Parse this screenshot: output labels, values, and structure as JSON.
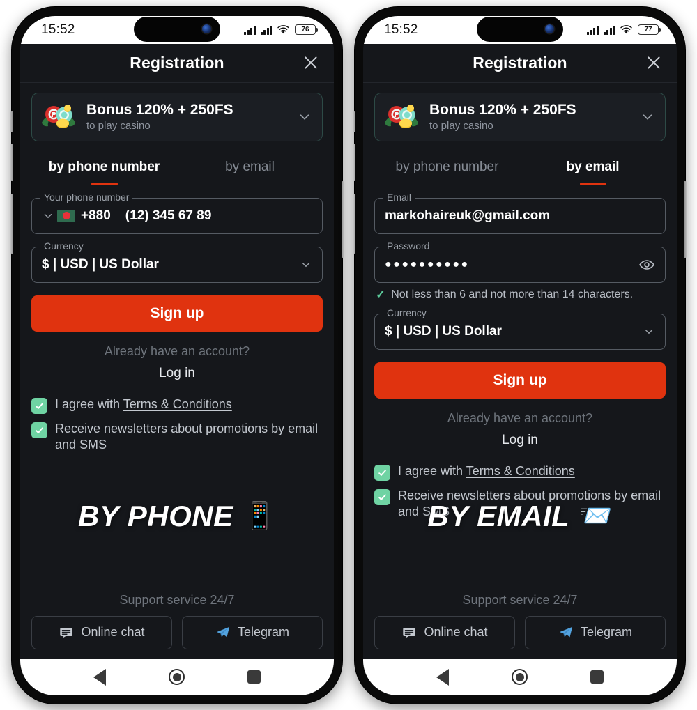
{
  "phones": [
    {
      "id": "phone-left",
      "status": {
        "time": "15:52",
        "battery": "76",
        "wifi_icon": "wifi-icon",
        "signal_icon": "signal-bars-icon"
      },
      "header": {
        "title": "Registration",
        "close_icon": "close-icon"
      },
      "bonus": {
        "title": "Bonus 120% + 250FS",
        "subtitle": "to play casino",
        "icon": "casino-chips-icon",
        "chevron": "chevron-down-icon"
      },
      "tabs": [
        {
          "label": "by phone number",
          "active": true
        },
        {
          "label": "by email",
          "active": false
        }
      ],
      "fields": [
        {
          "type": "phone",
          "label": "Your phone number",
          "country_flag": "bangladesh-flag-icon",
          "dial_code": "+880",
          "value": "",
          "placeholder": "(12) 345 67 89",
          "chevron": "chevron-down-icon"
        },
        {
          "type": "select",
          "label": "Currency",
          "value": "$ | USD | US Dollar",
          "chevron": "chevron-down-icon"
        }
      ],
      "signup_label": "Sign up",
      "already_text": "Already have an account?",
      "login_label": "Log in",
      "checkboxes": [
        {
          "checked": true,
          "prefix": "I agree with ",
          "link": "Terms & Conditions",
          "suffix": ""
        },
        {
          "checked": true,
          "prefix": "Receive newsletters about promotions by email and SMS",
          "link": "",
          "suffix": ""
        }
      ],
      "overlay": {
        "word": "BY PHONE",
        "emoji": "📱"
      },
      "footer": {
        "support": "Support service 24/7",
        "buttons": [
          {
            "label": "Online chat",
            "icon": "chat-bubble-icon"
          },
          {
            "label": "Telegram",
            "icon": "telegram-icon"
          }
        ]
      },
      "navbar": {
        "back": "back-icon",
        "home": "home-icon",
        "recent": "recent-apps-icon"
      }
    },
    {
      "id": "phone-right",
      "status": {
        "time": "15:52",
        "battery": "77",
        "wifi_icon": "wifi-icon",
        "signal_icon": "signal-bars-icon"
      },
      "header": {
        "title": "Registration",
        "close_icon": "close-icon"
      },
      "bonus": {
        "title": "Bonus 120% + 250FS",
        "subtitle": "to play casino",
        "icon": "casino-chips-icon",
        "chevron": "chevron-down-icon"
      },
      "tabs": [
        {
          "label": "by phone number",
          "active": false
        },
        {
          "label": "by email",
          "active": true
        }
      ],
      "fields": [
        {
          "type": "text",
          "label": "Email",
          "value": "markohaireuk@gmail.com",
          "placeholder": ""
        },
        {
          "type": "password",
          "label": "Password",
          "value": "●●●●●●●●●●",
          "eye_icon": "eye-icon"
        },
        {
          "type": "select",
          "label": "Currency",
          "value": "$ | USD | US Dollar",
          "chevron": "chevron-down-icon"
        }
      ],
      "password_hint": {
        "check_icon": "check-icon",
        "text": "Not less than 6 and not more than 14 characters."
      },
      "signup_label": "Sign up",
      "already_text": "Already have an account?",
      "login_label": "Log in",
      "checkboxes": [
        {
          "checked": true,
          "prefix": "I agree with ",
          "link": "Terms & Conditions",
          "suffix": ""
        },
        {
          "checked": true,
          "prefix": "Receive newsletters about promotions by email and SMS",
          "link": "",
          "suffix": ""
        }
      ],
      "overlay": {
        "word": "BY EMAIL",
        "emoji": "📨"
      },
      "footer": {
        "support": "Support service 24/7",
        "buttons": [
          {
            "label": "Online chat",
            "icon": "chat-bubble-icon"
          },
          {
            "label": "Telegram",
            "icon": "telegram-icon"
          }
        ]
      },
      "navbar": {
        "back": "back-icon",
        "home": "home-icon",
        "recent": "recent-apps-icon"
      }
    }
  ],
  "colors": {
    "accent_red": "#e0330f",
    "checkbox_green": "#6fd3a3",
    "screen_bg": "#15171b",
    "card_bg": "#1b1e23",
    "telegram_blue": "#53a3df",
    "muted_text": "#6e747c"
  }
}
